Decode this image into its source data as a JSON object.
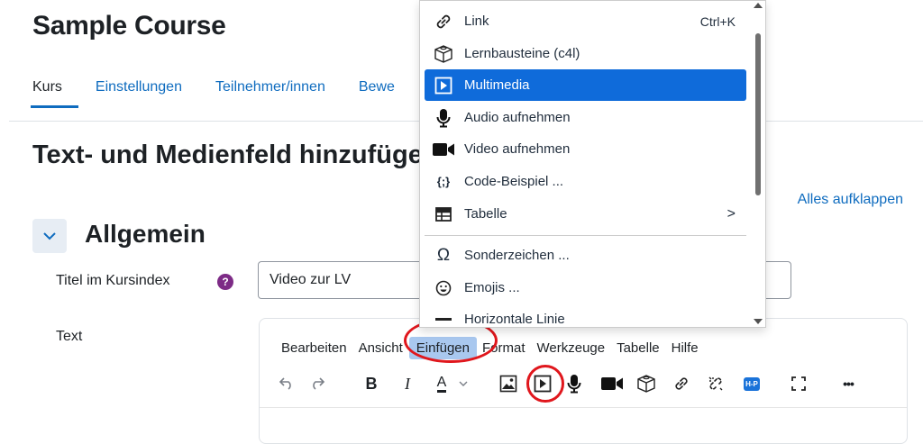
{
  "course": {
    "title": "Sample Course"
  },
  "tabs": [
    "Kurs",
    "Einstellungen",
    "Teilnehmer/innen",
    "Bewe"
  ],
  "page": {
    "heading": "Text- und Medienfeld hinzufügen",
    "expand_all": "Alles aufklappen"
  },
  "section": {
    "title": "Allgemein"
  },
  "fields": {
    "title_label": "Titel im Kursindex",
    "title_value": "Video zur LV",
    "text_label": "Text",
    "help_symbol": "?"
  },
  "editor": {
    "menubar": [
      "Bearbeiten",
      "Ansicht",
      "Einfügen",
      "Format",
      "Werkzeuge",
      "Tabelle",
      "Hilfe"
    ],
    "active_menu": "Einfügen",
    "toolbar_icons": [
      "undo-icon",
      "redo-icon",
      "bold-icon",
      "italic-icon",
      "text-color-icon",
      "image-icon",
      "media-icon",
      "microphone-icon",
      "video-camera-icon",
      "cube-icon",
      "link-icon",
      "unlink-icon",
      "h5p-icon",
      "fullscreen-icon",
      "more-icon"
    ],
    "bold_glyph": "B",
    "italic_glyph": "I",
    "color_glyph": "A",
    "h5p_label": "H-P",
    "more_glyph": "•••"
  },
  "insert_menu": {
    "items": [
      {
        "label": "Link",
        "icon": "link-icon",
        "shortcut": "Ctrl+K"
      },
      {
        "label": "Lernbausteine (c4l)",
        "icon": "cube-icon"
      },
      {
        "label": "Multimedia",
        "icon": "media-icon",
        "selected": true
      },
      {
        "label": "Audio aufnehmen",
        "icon": "microphone-icon"
      },
      {
        "label": "Video aufnehmen",
        "icon": "video-camera-icon"
      },
      {
        "label": "Code-Beispiel ...",
        "icon": "code-icon"
      },
      {
        "label": "Tabelle",
        "icon": "table-icon",
        "submenu": true
      },
      {
        "label": "Sonderzeichen ...",
        "icon": "omega-icon"
      },
      {
        "label": "Emojis ...",
        "icon": "emoji-icon"
      },
      {
        "label": "Horizontale Linie",
        "icon": "hr-icon"
      }
    ],
    "code_glyph": "{;}",
    "omega_glyph": "Ω",
    "chevron_glyph": ">"
  },
  "colors": {
    "primary": "#0f6cbf",
    "menu_selected": "#0f6bda",
    "highlight": "#a9c8ef",
    "annotation": "#e0171d",
    "help": "#7d2b86"
  }
}
